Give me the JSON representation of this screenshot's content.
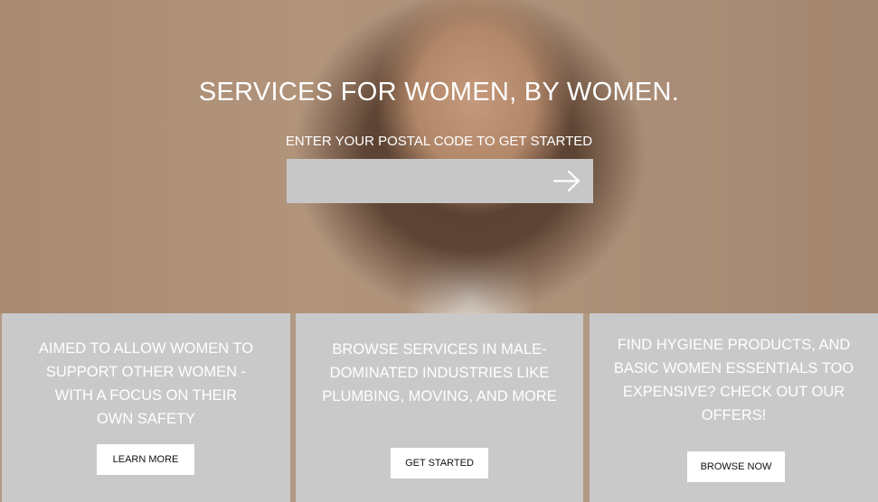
{
  "hero": {
    "title": "SERVICES FOR WOMEN, BY WOMEN.",
    "subtitle": "ENTER YOUR POSTAL CODE TO GET STARTED",
    "postal_input": {
      "value": "",
      "placeholder": ""
    },
    "submit_icon": "right-arrow-icon"
  },
  "cards": [
    {
      "text": "AIMED TO ALLOW WOMEN TO SUPPORT OTHER WOMEN - WITH A FOCUS ON THEIR OWN SAFETY",
      "button": "LEARN MORE"
    },
    {
      "text": "BROWSE SERVICES IN MALE-DOMINATED INDUSTRIES LIKE PLUMBING, MOVING, AND MORE",
      "button": "GET STARTED"
    },
    {
      "text": "FIND HYGIENE PRODUCTS, AND BASIC WOMEN ESSENTIALS TOO EXPENSIVE? CHECK OUT OUR OFFERS!",
      "button": "BROWSE NOW"
    }
  ],
  "colors": {
    "card_bg": "#c9c9c9",
    "divider": "#b29983",
    "input_bg": "#c7c7c7",
    "text": "#ffffff"
  }
}
